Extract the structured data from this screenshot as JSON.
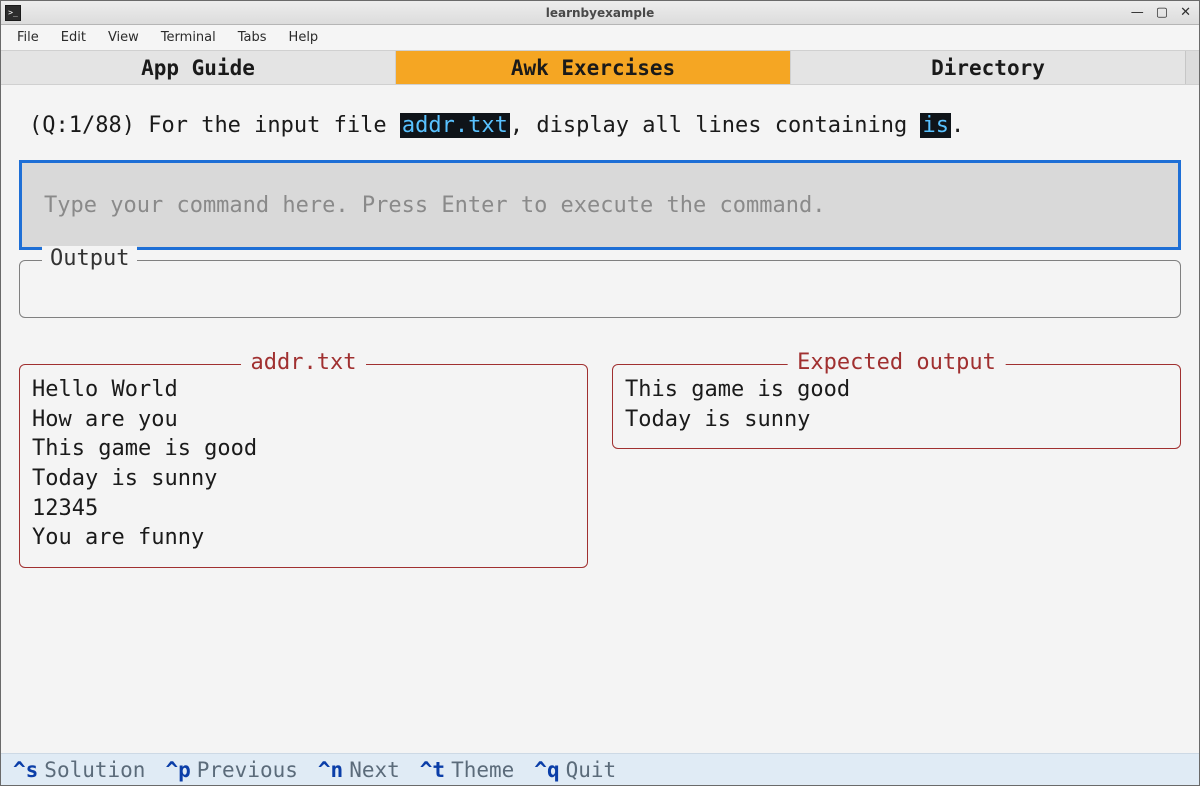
{
  "window": {
    "title": "learnbyexample",
    "icon_glyph": ">_"
  },
  "menubar": [
    "File",
    "Edit",
    "View",
    "Terminal",
    "Tabs",
    "Help"
  ],
  "tabs": [
    {
      "label": "App Guide",
      "active": false
    },
    {
      "label": "Awk Exercises",
      "active": true
    },
    {
      "label": "Directory",
      "active": false
    }
  ],
  "question": {
    "counter": "(Q:1/88)",
    "pre": " For the input file ",
    "code1": "addr.txt",
    "mid": ", display all lines containing ",
    "code2": "is",
    "post": "."
  },
  "command": {
    "placeholder": "Type your command here. Press Enter to execute the command.",
    "value": ""
  },
  "output": {
    "legend": "Output",
    "text": ""
  },
  "panel_input": {
    "legend": "addr.txt",
    "text": "Hello World\nHow are you\nThis game is good\nToday is sunny\n12345\nYou are funny"
  },
  "panel_expected": {
    "legend": "Expected output",
    "text": "This game is good\nToday is sunny"
  },
  "footer": [
    {
      "key": "^s",
      "label": "Solution"
    },
    {
      "key": "^p",
      "label": "Previous"
    },
    {
      "key": "^n",
      "label": "Next"
    },
    {
      "key": "^t",
      "label": "Theme"
    },
    {
      "key": "^q",
      "label": "Quit"
    }
  ]
}
